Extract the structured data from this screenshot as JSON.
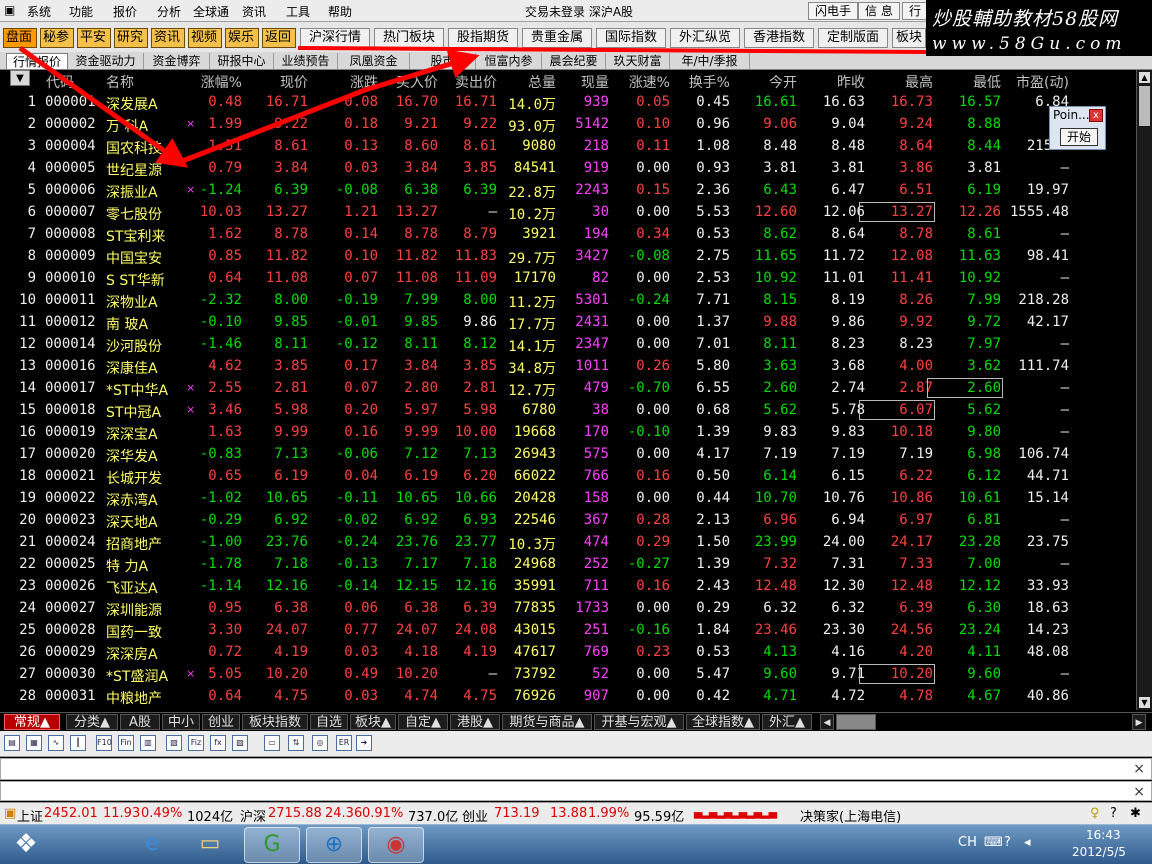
{
  "menu": {
    "items": [
      "系统",
      "功能",
      "报价",
      "分析",
      "全球通",
      "资讯",
      "工具",
      "帮助"
    ],
    "center_title": "交易未登录  深沪A股",
    "right_buttons": [
      "闪电手",
      "信 息",
      "行"
    ]
  },
  "watermark": {
    "line1": "炒股輔助教材58股网",
    "line2": "www.58Gu.com"
  },
  "toolbar": {
    "left": [
      "盘面",
      "秘参",
      "平安",
      "研究",
      "资讯",
      "视频",
      "娱乐",
      "返回"
    ],
    "right": [
      "沪深行情",
      "热门板块",
      "股指期货",
      "贵重金属",
      "国际指数",
      "外汇纵览",
      "香港指数",
      "定制版面",
      "板块"
    ]
  },
  "subtabs": [
    "行情报价",
    "资金驱动力",
    "资金博弈",
    "研报中心",
    "业绩预告",
    "凤凰资金",
    "股市",
    "恒富内参",
    "晨会纪要",
    "玖天财富",
    "年/中/季报"
  ],
  "table": {
    "sort_icon": "▼",
    "headers": [
      "代码",
      "名称",
      "涨幅%",
      "现价",
      "涨跌",
      "买入价",
      "卖出价",
      "总量",
      "现量",
      "涨速%",
      "换手%",
      "今开",
      "昨收",
      "最高",
      "最低",
      "市盈(动)"
    ],
    "rows": [
      [
        "1",
        "000001",
        "深发展A",
        "0.48",
        "16.71",
        "0.08",
        "16.70",
        "16.71",
        "14.0万",
        "939",
        "0.05",
        "0.45",
        "16.61",
        "16.63",
        "16.73",
        "16.57",
        "6.84"
      ],
      [
        "2",
        "000002",
        "万 科A",
        "1.99",
        "9.22",
        "0.18",
        "9.21",
        "9.22",
        "93.0万",
        "5142",
        "0.10",
        "0.96",
        "9.06",
        "9.04",
        "9.24",
        "8.88",
        "18"
      ],
      [
        "3",
        "000004",
        "国农科技",
        "1.51",
        "8.61",
        "0.13",
        "8.60",
        "8.61",
        "9080",
        "218",
        "0.11",
        "1.08",
        "8.48",
        "8.48",
        "8.64",
        "8.44",
        "21519"
      ],
      [
        "4",
        "000005",
        "世纪星源",
        "0.79",
        "3.84",
        "0.03",
        "3.84",
        "3.85",
        "84541",
        "919",
        "0.00",
        "0.93",
        "3.81",
        "3.81",
        "3.86",
        "3.81",
        "—"
      ],
      [
        "5",
        "000006",
        "深振业A",
        "-1.24",
        "6.39",
        "-0.08",
        "6.38",
        "6.39",
        "22.8万",
        "2243",
        "0.15",
        "2.36",
        "6.43",
        "6.47",
        "6.51",
        "6.19",
        "19.97"
      ],
      [
        "6",
        "000007",
        "零七股份",
        "10.03",
        "13.27",
        "1.21",
        "13.27",
        "—",
        "10.2万",
        "30",
        "0.00",
        "5.53",
        "12.60",
        "12.06",
        "13.27",
        "12.26",
        "1555.48"
      ],
      [
        "7",
        "000008",
        "ST宝利来",
        "1.62",
        "8.78",
        "0.14",
        "8.78",
        "8.79",
        "3921",
        "194",
        "0.34",
        "0.53",
        "8.62",
        "8.64",
        "8.78",
        "8.61",
        "—"
      ],
      [
        "8",
        "000009",
        "中国宝安",
        "0.85",
        "11.82",
        "0.10",
        "11.82",
        "11.83",
        "29.7万",
        "3427",
        "-0.08",
        "2.75",
        "11.65",
        "11.72",
        "12.08",
        "11.63",
        "98.41"
      ],
      [
        "9",
        "000010",
        "S ST华新",
        "0.64",
        "11.08",
        "0.07",
        "11.08",
        "11.09",
        "17170",
        "82",
        "0.00",
        "2.53",
        "10.92",
        "11.01",
        "11.41",
        "10.92",
        "—"
      ],
      [
        "10",
        "000011",
        "深物业A",
        "-2.32",
        "8.00",
        "-0.19",
        "7.99",
        "8.00",
        "11.2万",
        "5301",
        "-0.24",
        "7.71",
        "8.15",
        "8.19",
        "8.26",
        "7.99",
        "218.28"
      ],
      [
        "11",
        "000012",
        "南 玻A",
        "-0.10",
        "9.85",
        "-0.01",
        "9.85",
        "9.86",
        "17.7万",
        "2431",
        "0.00",
        "1.37",
        "9.88",
        "9.86",
        "9.92",
        "9.72",
        "42.17"
      ],
      [
        "12",
        "000014",
        "沙河股份",
        "-1.46",
        "8.11",
        "-0.12",
        "8.11",
        "8.12",
        "14.1万",
        "2347",
        "0.00",
        "7.01",
        "8.11",
        "8.23",
        "8.23",
        "7.97",
        "—"
      ],
      [
        "13",
        "000016",
        "深康佳A",
        "4.62",
        "3.85",
        "0.17",
        "3.84",
        "3.85",
        "34.8万",
        "1011",
        "0.26",
        "5.80",
        "3.63",
        "3.68",
        "4.00",
        "3.62",
        "111.74"
      ],
      [
        "14",
        "000017",
        "*ST中华A",
        "2.55",
        "2.81",
        "0.07",
        "2.80",
        "2.81",
        "12.7万",
        "479",
        "-0.70",
        "6.55",
        "2.60",
        "2.74",
        "2.87",
        "2.60",
        "—"
      ],
      [
        "15",
        "000018",
        "ST中冠A",
        "3.46",
        "5.98",
        "0.20",
        "5.97",
        "5.98",
        "6780",
        "38",
        "0.00",
        "0.68",
        "5.62",
        "5.78",
        "6.07",
        "5.62",
        "—"
      ],
      [
        "16",
        "000019",
        "深深宝A",
        "1.63",
        "9.99",
        "0.16",
        "9.99",
        "10.00",
        "19668",
        "170",
        "-0.10",
        "1.39",
        "9.83",
        "9.83",
        "10.18",
        "9.80",
        "—"
      ],
      [
        "17",
        "000020",
        "深华发A",
        "-0.83",
        "7.13",
        "-0.06",
        "7.12",
        "7.13",
        "26943",
        "575",
        "0.00",
        "4.17",
        "7.19",
        "7.19",
        "7.19",
        "6.98",
        "106.74"
      ],
      [
        "18",
        "000021",
        "长城开发",
        "0.65",
        "6.19",
        "0.04",
        "6.19",
        "6.20",
        "66022",
        "766",
        "0.16",
        "0.50",
        "6.14",
        "6.15",
        "6.22",
        "6.12",
        "44.71"
      ],
      [
        "19",
        "000022",
        "深赤湾A",
        "-1.02",
        "10.65",
        "-0.11",
        "10.65",
        "10.66",
        "20428",
        "158",
        "0.00",
        "0.44",
        "10.70",
        "10.76",
        "10.86",
        "10.61",
        "15.14"
      ],
      [
        "20",
        "000023",
        "深天地A",
        "-0.29",
        "6.92",
        "-0.02",
        "6.92",
        "6.93",
        "22546",
        "367",
        "0.28",
        "2.13",
        "6.96",
        "6.94",
        "6.97",
        "6.81",
        "—"
      ],
      [
        "21",
        "000024",
        "招商地产",
        "-1.00",
        "23.76",
        "-0.24",
        "23.76",
        "23.77",
        "10.3万",
        "474",
        "0.29",
        "1.50",
        "23.99",
        "24.00",
        "24.17",
        "23.28",
        "23.75"
      ],
      [
        "22",
        "000025",
        "特 力A",
        "-1.78",
        "7.18",
        "-0.13",
        "7.17",
        "7.18",
        "24968",
        "252",
        "-0.27",
        "1.39",
        "7.32",
        "7.31",
        "7.33",
        "7.00",
        "—"
      ],
      [
        "23",
        "000026",
        "飞亚达A",
        "-1.14",
        "12.16",
        "-0.14",
        "12.15",
        "12.16",
        "35991",
        "711",
        "0.16",
        "2.43",
        "12.48",
        "12.30",
        "12.48",
        "12.12",
        "33.93"
      ],
      [
        "24",
        "000027",
        "深圳能源",
        "0.95",
        "6.38",
        "0.06",
        "6.38",
        "6.39",
        "77835",
        "1733",
        "0.00",
        "0.29",
        "6.32",
        "6.32",
        "6.39",
        "6.30",
        "18.63"
      ],
      [
        "25",
        "000028",
        "国药一致",
        "3.30",
        "24.07",
        "0.77",
        "24.07",
        "24.08",
        "43015",
        "251",
        "-0.16",
        "1.84",
        "23.46",
        "23.30",
        "24.56",
        "23.24",
        "14.23"
      ],
      [
        "26",
        "000029",
        "深深房A",
        "0.72",
        "4.19",
        "0.03",
        "4.18",
        "4.19",
        "47617",
        "769",
        "0.23",
        "0.53",
        "4.13",
        "4.16",
        "4.20",
        "4.11",
        "48.08"
      ],
      [
        "27",
        "000030",
        "*ST盛润A",
        "5.05",
        "10.20",
        "0.49",
        "10.20",
        "—",
        "73792",
        "52",
        "0.00",
        "5.47",
        "9.60",
        "9.71",
        "10.20",
        "9.60",
        "—"
      ],
      [
        "28",
        "000031",
        "中粮地产",
        "0.64",
        "4.75",
        "0.03",
        "4.74",
        "4.75",
        "76926",
        "907",
        "0.00",
        "0.42",
        "4.71",
        "4.72",
        "4.78",
        "4.67",
        "40.86"
      ]
    ],
    "marked_rows": [
      2,
      5,
      14,
      15,
      27
    ],
    "boxed_cells": [
      [
        6,
        "high"
      ],
      [
        14,
        "low"
      ],
      [
        15,
        "high"
      ],
      [
        27,
        "high"
      ]
    ]
  },
  "bottom_tabs": [
    "常规▲",
    "分类▲",
    "A股",
    "中小",
    "创业",
    "板块指数",
    "自选",
    "板块▲",
    "自定▲",
    "港股▲",
    "期货与商品▲",
    "开基与宏观▲",
    "全球指数▲",
    "外汇▲"
  ],
  "status": {
    "sh_label": "上证",
    "sh_value": "2452.01",
    "sh_change": "11.93",
    "sh_pct": "0.49%",
    "sh_vol": "1024亿",
    "sz_label": "沪深",
    "sz_value": "2715.88",
    "sz_change": "24.36",
    "sz_pct": "0.91%",
    "sz_vol": "737.0亿",
    "cy_label": "创业",
    "cy_value": "713.19",
    "cy_change": "13.88",
    "cy_pct": "1.99%",
    "cy_vol": "95.59亿",
    "broker": "决策家(上海电信)"
  },
  "popup": {
    "title": "Poin...",
    "button": "开始",
    "close": "x"
  },
  "taskbar": {
    "lang": "CH",
    "time": "16:43",
    "date": "2012/5/5"
  },
  "colors": {
    "up": "#ff4040",
    "down": "#00dd00",
    "name": "#ffff66",
    "volume": "#ff40ff",
    "arrow": "#ff0000"
  }
}
